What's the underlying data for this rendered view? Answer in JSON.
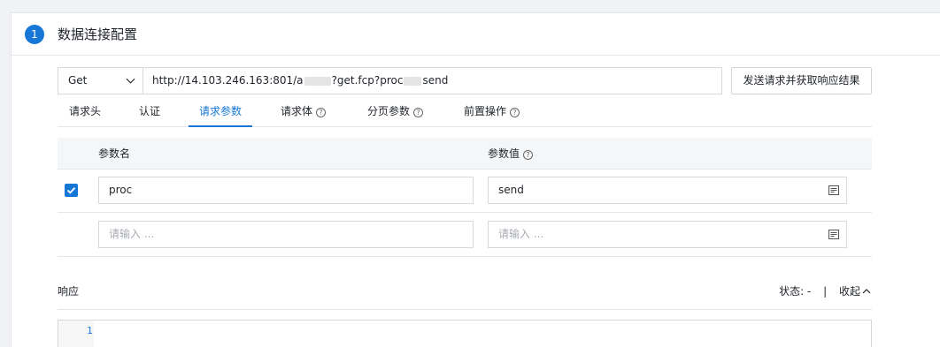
{
  "step": {
    "number": "1",
    "title": "数据连接配置"
  },
  "request": {
    "method": "Get",
    "url_visible_parts": [
      "http://14.103.246.163:801/a",
      "?get.fcp?proc",
      "send"
    ],
    "send_label": "发送请求并获取响应结果"
  },
  "tabs": [
    {
      "label": "请求头",
      "active": false,
      "help": false
    },
    {
      "label": "认证",
      "active": false,
      "help": false
    },
    {
      "label": "请求参数",
      "active": true,
      "help": false
    },
    {
      "label": "请求体",
      "active": false,
      "help": true
    },
    {
      "label": "分页参数",
      "active": false,
      "help": true
    },
    {
      "label": "前置操作",
      "active": false,
      "help": true
    }
  ],
  "params_table": {
    "col_name": "参数名",
    "col_value": "参数值",
    "rows": [
      {
        "checked": true,
        "name": "proc",
        "value": "send"
      }
    ],
    "empty_row": {
      "name_placeholder": "请输入 ...",
      "value_placeholder": "请输入 ..."
    }
  },
  "response": {
    "label": "响应",
    "status_label": "状态: -",
    "separator": "|",
    "collapse_label": "收起",
    "line_number": "1"
  },
  "colors": {
    "accent": "#1677d6",
    "border": "#d9d9d9",
    "header_bg": "#f5f6f7",
    "page_bg": "#f0f2f5"
  },
  "icons": [
    "chevron-down-icon",
    "help-circle-icon",
    "checkbox-checked-icon",
    "editor-icon",
    "chevron-up-icon"
  ]
}
